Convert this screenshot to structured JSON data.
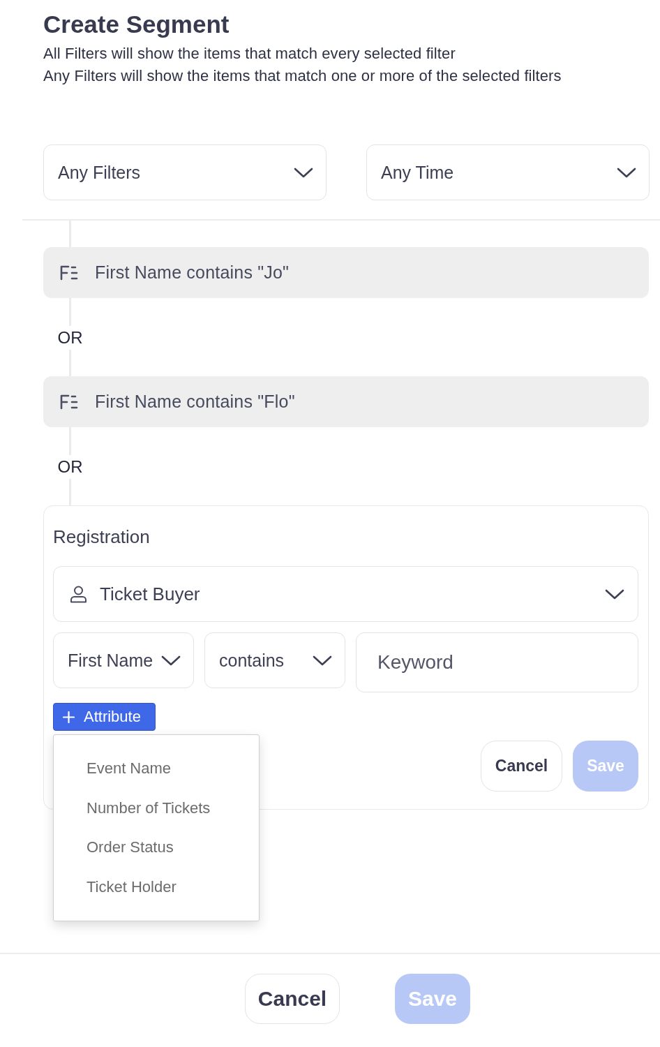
{
  "header": {
    "title": "Create Segment",
    "description": [
      "All Filters will show the items that match every selected filter",
      "Any Filters will show the items that match one or more of the selected filters"
    ]
  },
  "selects": [
    {
      "value": "Any Filters"
    },
    {
      "value": "Any Time"
    }
  ],
  "conditions": [
    {
      "label": "First Name contains \"Jo\"",
      "joiner": "OR"
    },
    {
      "label": "First Name contains \"Flo\"",
      "joiner": "OR"
    }
  ],
  "editor": {
    "group": "Registration",
    "entity": {
      "value": "Ticket Buyer"
    },
    "attribute": {
      "value": "First Name"
    },
    "operator": {
      "value": "contains"
    },
    "keyword": {
      "placeholder": "Keyword"
    },
    "add_button": {
      "label": "Attribute"
    },
    "attribute_menu": {
      "open": true,
      "items": [
        "Event Name",
        "Number of Tickets",
        "Order Status",
        "Ticket Holder"
      ]
    },
    "buttons": [
      {
        "label": "Cancel",
        "kind": "secondary",
        "disabled": false
      },
      {
        "label": "Save",
        "kind": "primary",
        "disabled": true
      }
    ]
  },
  "footer": {
    "buttons": [
      {
        "label": "Cancel",
        "kind": "secondary",
        "disabled": false
      },
      {
        "label": "Save",
        "kind": "primary",
        "disabled": true
      }
    ]
  }
}
